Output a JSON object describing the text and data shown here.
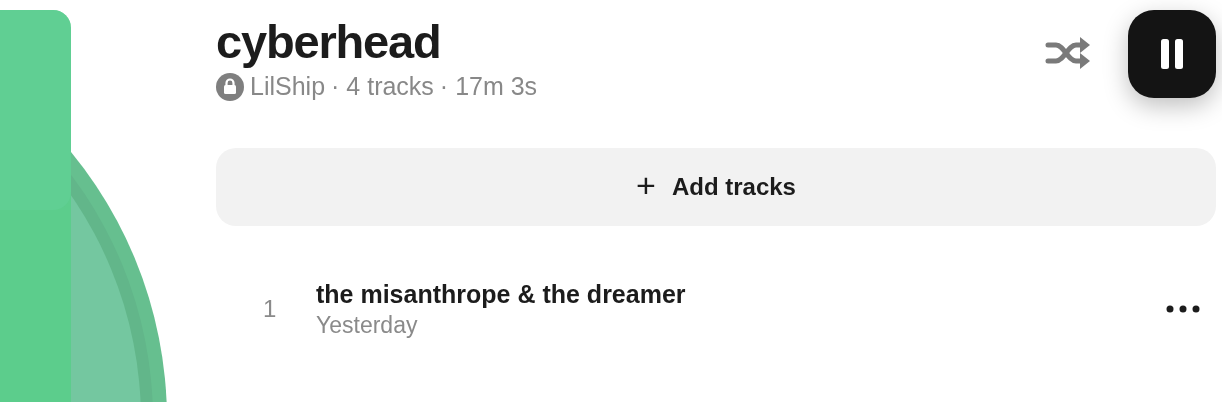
{
  "playlist": {
    "title": "cyberhead",
    "private": true,
    "owner": "LilShip",
    "track_count": "· 4 tracks",
    "duration": "· 17m 3s"
  },
  "playback": {
    "playing": true
  },
  "add_button": {
    "icon": "+",
    "label": "Add tracks"
  },
  "tracks": [
    {
      "number": "1",
      "title": "the misanthrope & the dreamer",
      "added": "Yesterday"
    }
  ]
}
